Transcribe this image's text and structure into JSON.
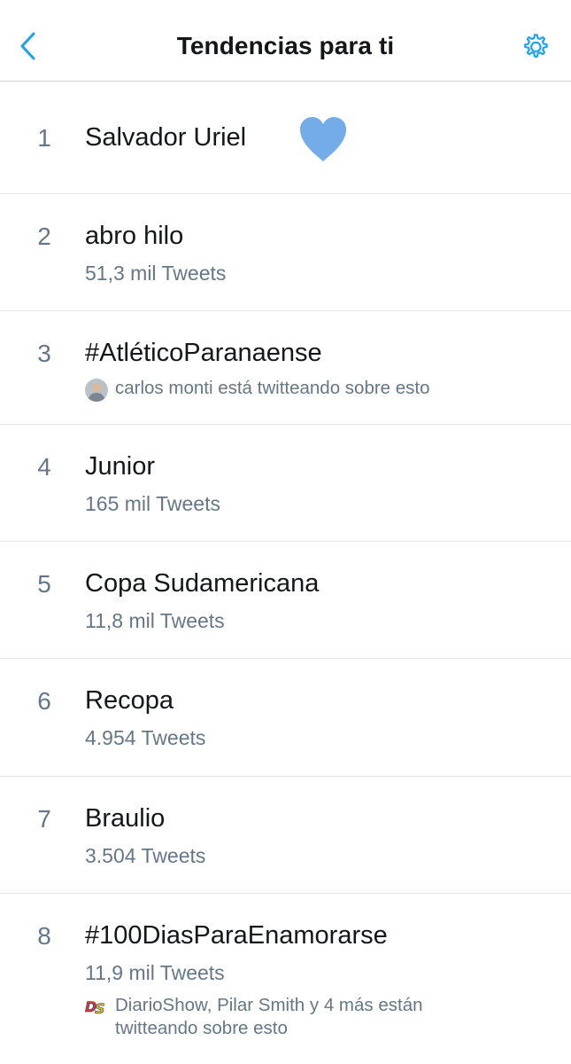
{
  "header": {
    "title": "Tendencias para ti",
    "back_icon": "chevron-left-icon",
    "settings_icon": "gear-icon",
    "accent_color": "#1da1f2"
  },
  "trends": [
    {
      "rank": "1",
      "name": "Salvador Uriel",
      "emoji": "blue-heart-icon"
    },
    {
      "rank": "2",
      "name": "abro hilo",
      "count": "51,3 mil Tweets"
    },
    {
      "rank": "3",
      "name": "#AtléticoParanaense",
      "social": "carlos monti está twitteando sobre esto"
    },
    {
      "rank": "4",
      "name": "Junior",
      "count": "165 mil Tweets"
    },
    {
      "rank": "5",
      "name": "Copa Sudamericana",
      "count": "11,8 mil Tweets"
    },
    {
      "rank": "6",
      "name": "Recopa",
      "count": "4.954 Tweets"
    },
    {
      "rank": "7",
      "name": "Braulio",
      "count": "3.504 Tweets"
    },
    {
      "rank": "8",
      "name": "#100DiasParaEnamorarse",
      "count": "11,9 mil Tweets",
      "social_line1": "DiarioShow, Pilar Smith y 4 más están",
      "social_line2": "twitteando sobre esto"
    }
  ]
}
